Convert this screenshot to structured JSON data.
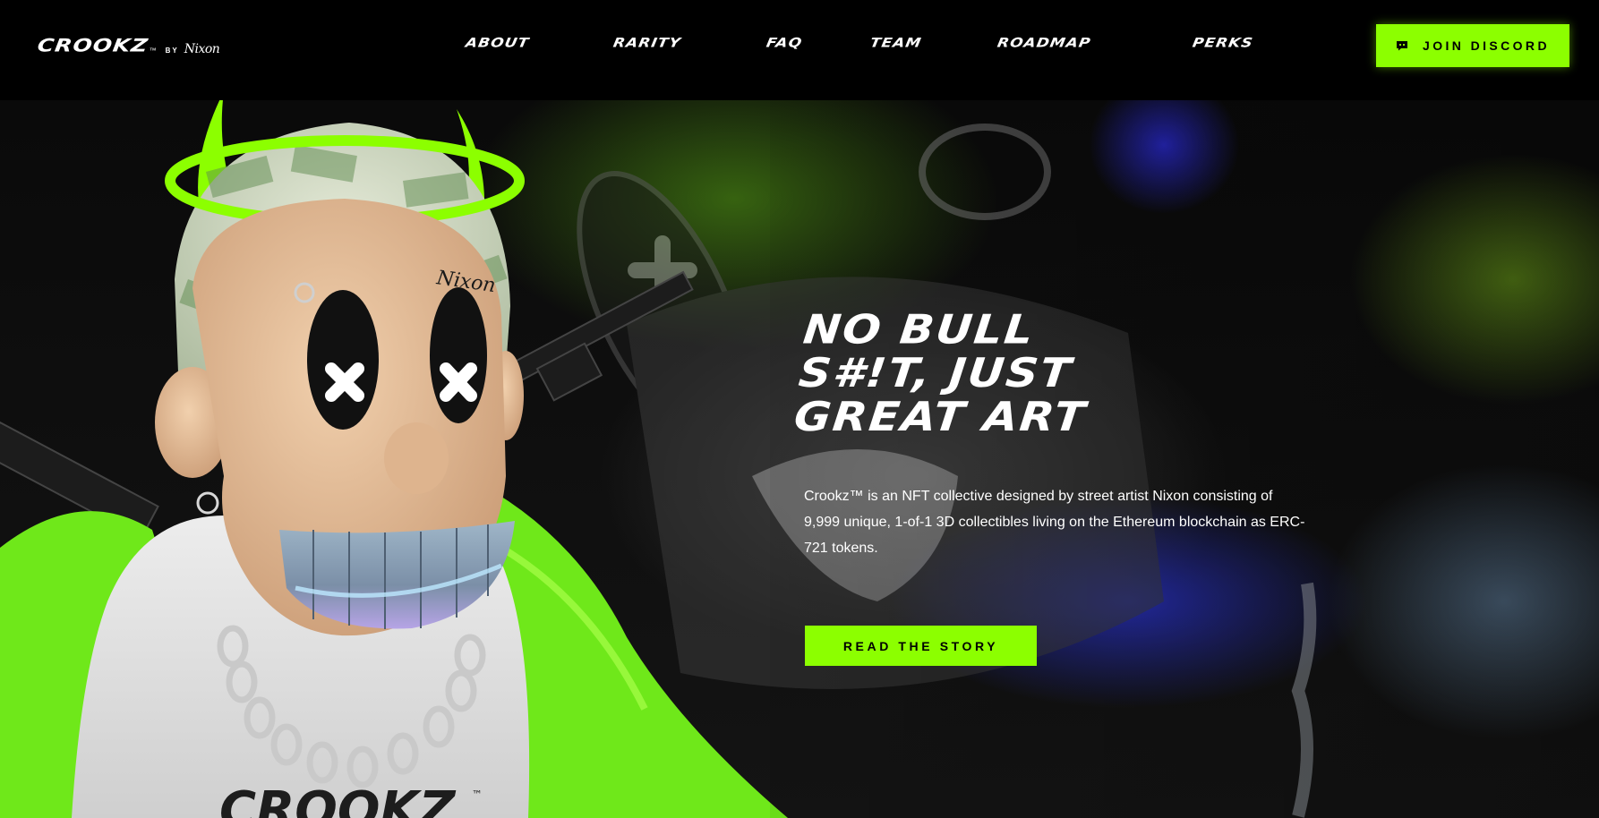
{
  "header": {
    "logo": {
      "wordmark": "CROOKZ",
      "trademark": "™",
      "by": "BY",
      "artist": "Nixon"
    },
    "nav": [
      {
        "label": "ABOUT"
      },
      {
        "label": "RARITY"
      },
      {
        "label": "FAQ"
      },
      {
        "label": "TEAM"
      },
      {
        "label": "ROADMAP"
      },
      {
        "label": "PERKS"
      }
    ],
    "cta": {
      "label": "JOIN DISCORD",
      "icon": "discord-icon"
    }
  },
  "hero": {
    "headline_lines": [
      "NO BULL",
      "S#!T, JUST",
      "GREAT ART"
    ],
    "description": "Crookz™ is an NFT collective designed by street artist Nixon consisting of 9,999 unique, 1-of-1 3D collectibles living on the Ethereum blockchain as ERC-721 tokens.",
    "cta": {
      "label": "READ THE STORY"
    },
    "artwork": {
      "forehead_tag": "Nixon",
      "hoodie_print": "CROOKZ",
      "hoodie_tm": "™"
    }
  },
  "colors": {
    "accent": "#8cff00",
    "background": "#000000",
    "text": "#ffffff"
  }
}
